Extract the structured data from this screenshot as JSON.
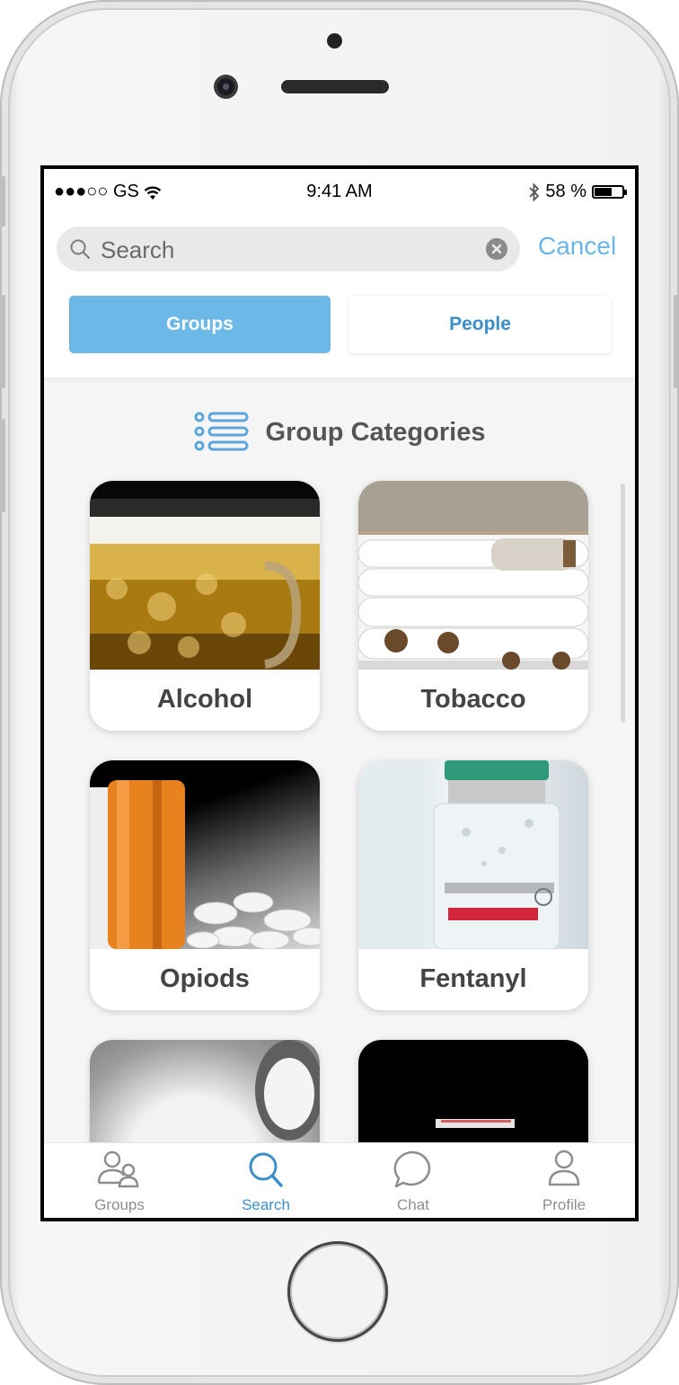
{
  "status_bar": {
    "carrier": "●●●○○ GS",
    "time": "9:41 AM",
    "battery_percent": "58 %",
    "battery_level": 0.58
  },
  "search": {
    "placeholder": "Search",
    "cancel_label": "Cancel"
  },
  "segments": {
    "groups_label": "Groups",
    "people_label": "People",
    "selected": "Groups"
  },
  "section": {
    "title": "Group Categories"
  },
  "categories": [
    {
      "label": "Alcohol",
      "image": "beer-mug"
    },
    {
      "label": "Tobacco",
      "image": "cigarettes"
    },
    {
      "label": "Opiods",
      "image": "pill-bottle"
    },
    {
      "label": "Fentanyl",
      "image": "fentanyl-vial"
    },
    {
      "label": "",
      "image": "white-powder"
    },
    {
      "label": "",
      "image": "crystal-bag"
    }
  ],
  "tabbar": {
    "items": [
      {
        "label": "Groups",
        "icon": "groups-icon"
      },
      {
        "label": "Search",
        "icon": "search-icon"
      },
      {
        "label": "Chat",
        "icon": "chat-icon"
      },
      {
        "label": "Profile",
        "icon": "profile-icon"
      }
    ],
    "active": "Search"
  },
  "colors": {
    "accent": "#6cb8e6",
    "accent_text": "#3c8fc8",
    "label": "#444444"
  }
}
